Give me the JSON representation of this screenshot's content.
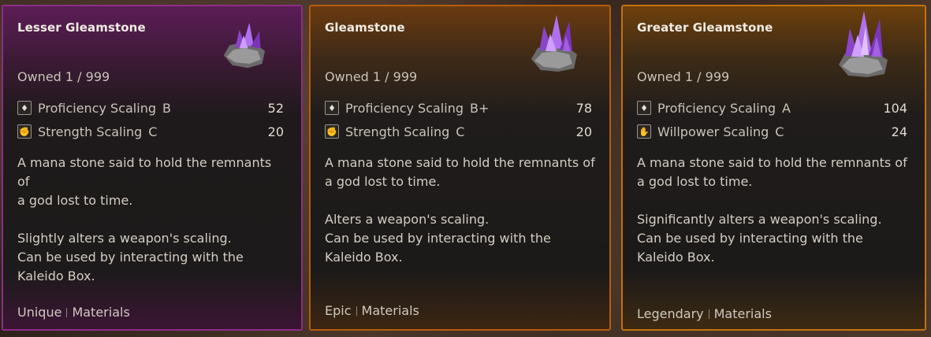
{
  "cards": [
    {
      "title": "Lesser Gleamstone",
      "owned": "Owned 1 / 999",
      "stats": [
        {
          "icon": "proficiency-icon",
          "name": "Proficiency Scaling",
          "grade": "B",
          "value": "52"
        },
        {
          "icon": "strength-icon",
          "name": "Strength Scaling",
          "grade": "C",
          "value": "20"
        }
      ],
      "description_lines": [
        "A mana stone said to hold the remnants of",
        "a god lost to time."
      ],
      "effect_lines": [
        "Slightly alters a weapon's scaling.",
        "Can be used by interacting with the",
        "Kaleido Box."
      ],
      "rarity": "Unique",
      "category": "Materials",
      "border_color": "#8b2f86"
    },
    {
      "title": "Gleamstone",
      "owned": "Owned 1 / 999",
      "stats": [
        {
          "icon": "proficiency-icon",
          "name": "Proficiency Scaling",
          "grade": "B+",
          "value": "78"
        },
        {
          "icon": "strength-icon",
          "name": "Strength Scaling",
          "grade": "C",
          "value": "20"
        }
      ],
      "description_lines": [
        "A mana stone said to hold the remnants of",
        "a god lost to time."
      ],
      "effect_lines": [
        "Alters a weapon's scaling.",
        "Can be used by interacting with the",
        "Kaleido Box."
      ],
      "rarity": "Epic",
      "category": "Materials",
      "border_color": "#b45c0c"
    },
    {
      "title": "Greater Gleamstone",
      "owned": "Owned 1 / 999",
      "stats": [
        {
          "icon": "proficiency-icon",
          "name": "Proficiency Scaling",
          "grade": "A",
          "value": "104"
        },
        {
          "icon": "willpower-icon",
          "name": "Willpower Scaling",
          "grade": "C",
          "value": "24"
        }
      ],
      "description_lines": [
        "A mana stone said to hold the remnants of",
        "a god lost to time."
      ],
      "effect_lines": [
        "Significantly alters a weapon's scaling.",
        "Can be used by interacting with the",
        "Kaleido Box."
      ],
      "rarity": "Legendary",
      "category": "Materials",
      "border_color": "#c3720d"
    }
  ]
}
